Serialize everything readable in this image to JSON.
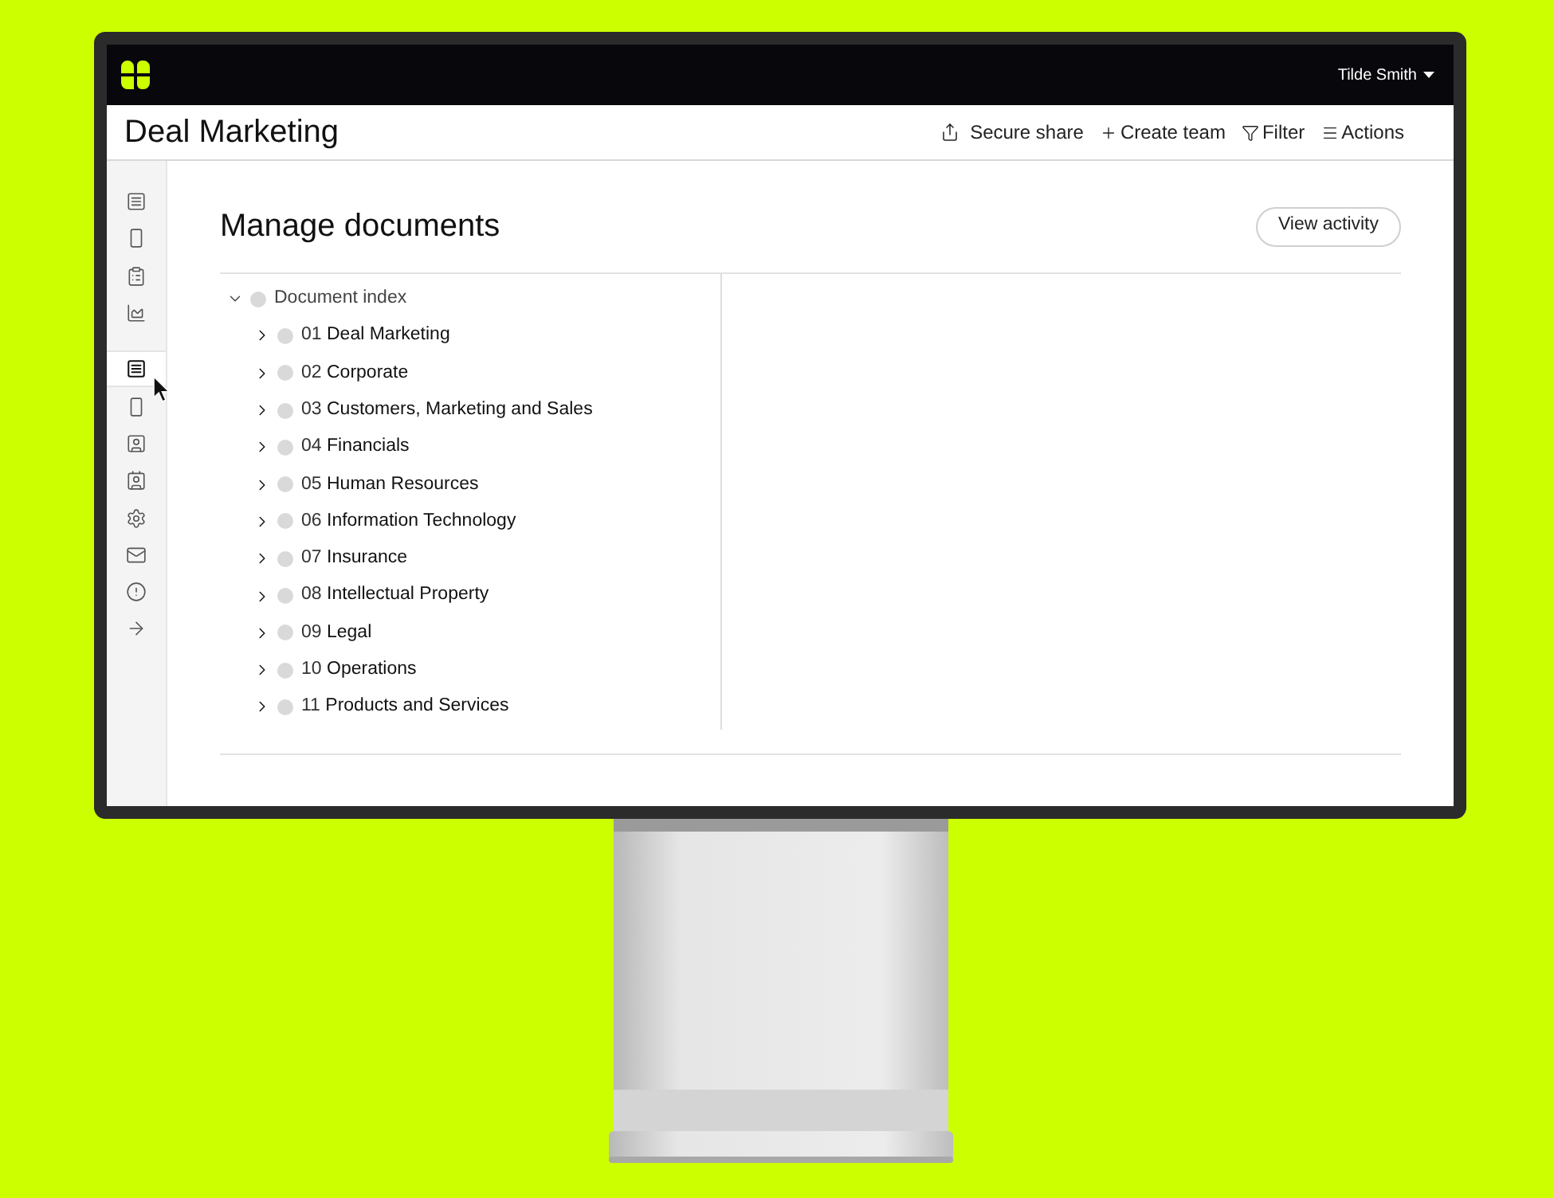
{
  "top_bar": {
    "user": "Tilde Smith"
  },
  "header": {
    "title": "Deal Marketing",
    "actions": [
      {
        "kind": "share",
        "label": "Secure share"
      },
      {
        "kind": "plus",
        "label": "Create team"
      },
      {
        "kind": "filter",
        "label": "Filter"
      },
      {
        "kind": "menu",
        "label": "Actions"
      }
    ]
  },
  "sidebar": {
    "groups": [
      {
        "items": [
          {
            "kind": "list",
            "selected": false
          },
          {
            "kind": "tablet",
            "selected": false
          },
          {
            "kind": "clipboard",
            "selected": false
          },
          {
            "kind": "chart",
            "selected": false
          }
        ]
      },
      {
        "items": [
          {
            "kind": "list",
            "selected": true
          },
          {
            "kind": "tablet",
            "selected": false
          },
          {
            "kind": "user",
            "selected": false
          },
          {
            "kind": "contacts",
            "selected": false
          },
          {
            "kind": "settings",
            "selected": false
          },
          {
            "kind": "mail",
            "selected": false
          },
          {
            "kind": "alert",
            "selected": false
          },
          {
            "kind": "arrow",
            "selected": false
          }
        ]
      }
    ]
  },
  "main": {
    "title": "Manage documents",
    "button": "View activity",
    "tree": {
      "label": "Document index",
      "expanded": true,
      "children": [
        {
          "number": "01",
          "name": "Deal Marketing",
          "expanded": false
        },
        {
          "number": "02",
          "name": "Corporate",
          "expanded": false
        },
        {
          "number": "03",
          "name": "Customers, Marketing and Sales",
          "expanded": false
        },
        {
          "number": "04",
          "name": "Financials",
          "expanded": false
        },
        {
          "number": "05",
          "name": "Human Resources",
          "expanded": false
        },
        {
          "number": "06",
          "name": "Information Technology",
          "expanded": false
        },
        {
          "number": "07",
          "name": "Insurance",
          "expanded": false
        },
        {
          "number": "08",
          "name": "Intellectual Property",
          "expanded": false
        },
        {
          "number": "09",
          "name": "Legal",
          "expanded": false
        },
        {
          "number": "10",
          "name": "Operations",
          "expanded": false
        },
        {
          "number": "11",
          "name": "Products and Services",
          "expanded": false
        }
      ]
    }
  }
}
